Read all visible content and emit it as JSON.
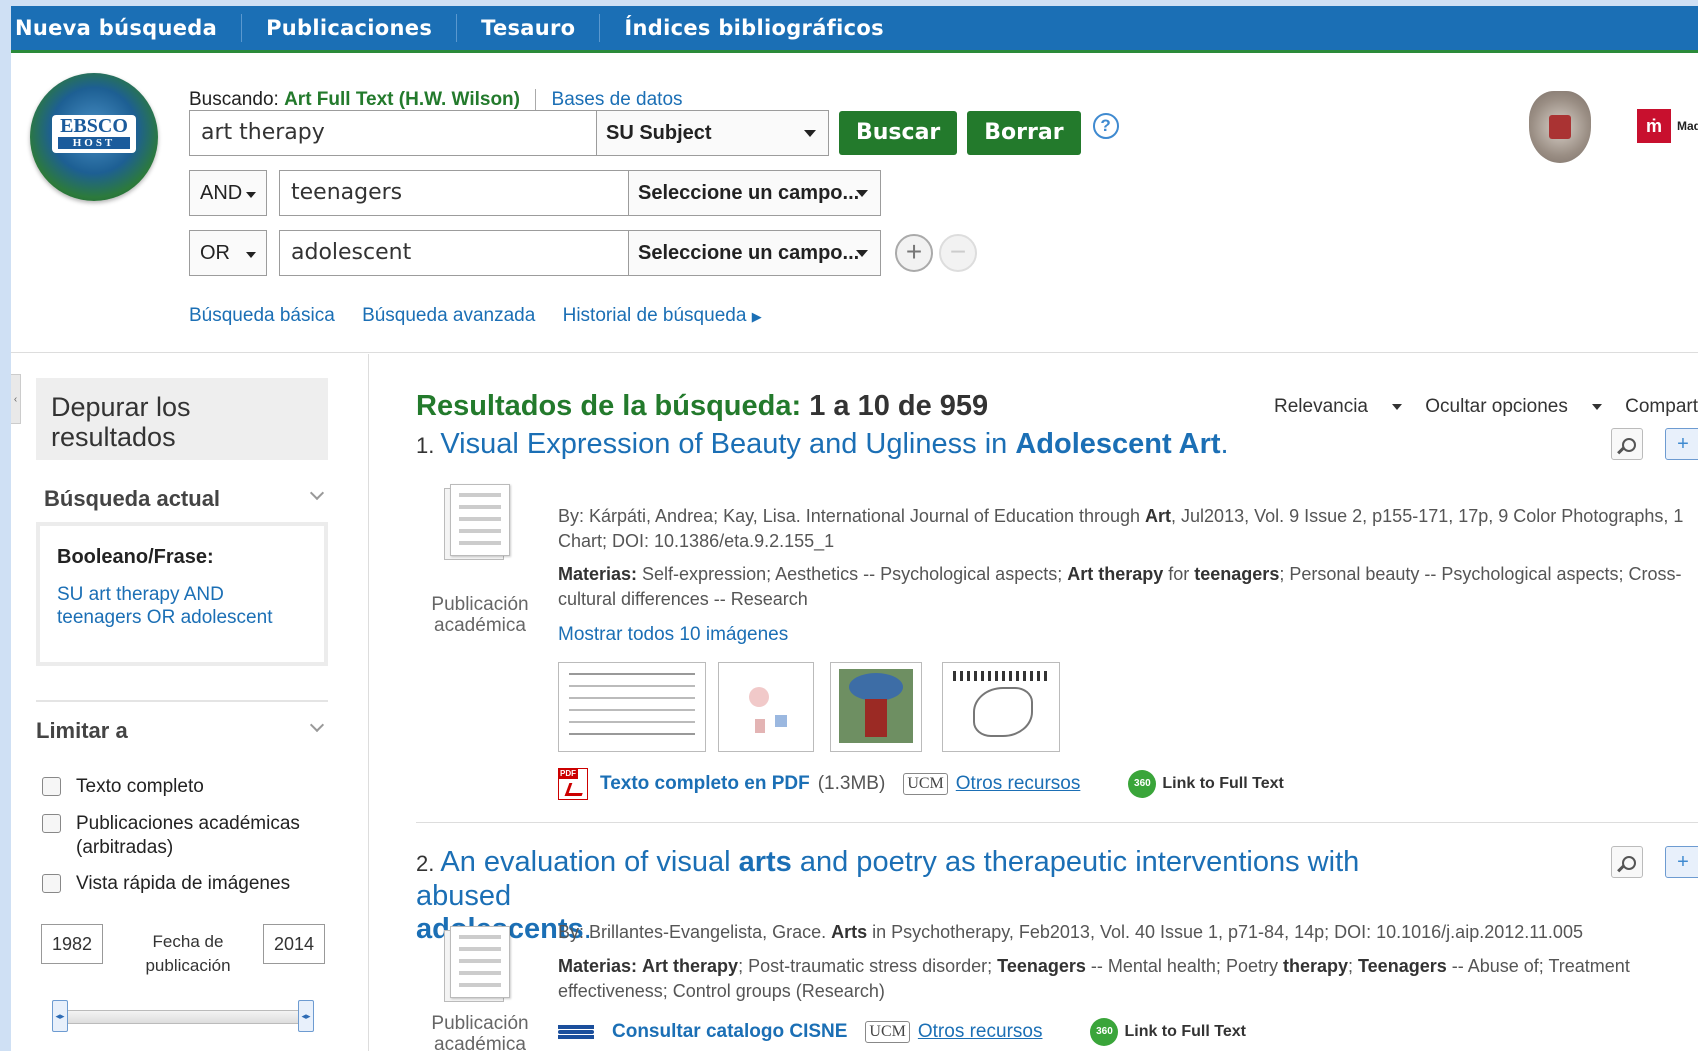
{
  "nav": {
    "items": [
      "Nueva búsqueda",
      "Publicaciones",
      "Tesauro",
      "Índices bibliográficos"
    ]
  },
  "logo": {
    "brand": "EBSCO",
    "sub": "HOST"
  },
  "search": {
    "searching_label": "Buscando:",
    "database": "Art Full Text (H.W. Wilson)",
    "databases_link": "Bases de datos",
    "rows": [
      {
        "op": "",
        "text": "art therapy",
        "field": "SU Subject"
      },
      {
        "op": "AND",
        "text": "teenagers",
        "field": "Seleccione un campo..."
      },
      {
        "op": "OR",
        "text": "adolescent",
        "field": "Seleccione un campo..."
      }
    ],
    "search_button": "Buscar",
    "clear_button": "Borrar",
    "help": "?",
    "add": "+",
    "remove": "−"
  },
  "sublinks": [
    "Búsqueda básica",
    "Búsqueda avanzada",
    "Historial de búsqueda"
  ],
  "madrid_label": "Madr",
  "sidebar": {
    "refine_title": "Depurar los resultados",
    "current_search_title": "Búsqueda actual",
    "boolean_label": "Booleano/Frase:",
    "query": "SU art therapy AND teenagers OR adolescent",
    "limit_title": "Limitar a",
    "limits": [
      "Texto completo",
      "Publicaciones académicas (arbitradas)",
      "Vista rápida de imágenes"
    ],
    "year_from": "1982",
    "year_to": "2014",
    "date_label": "Fecha de publicación",
    "date_range": [
      0.0,
      1.0
    ]
  },
  "results": {
    "heading": "Resultados de la búsqueda:",
    "count": "1 a 10 de 959",
    "sort": "Relevancia",
    "options": "Ocultar opciones",
    "share": "Compartir",
    "items": [
      {
        "num": "1.",
        "title_pre": "Visual Expression of Beauty and Ugliness in ",
        "title_bold": "Adolescent Art",
        "title_post": ".",
        "type": "Publicación académica",
        "cite_pre": "By: Kárpáti, Andrea; Kay, Lisa. International Journal of Education through ",
        "cite_bold": "Art",
        "cite_post": ", Jul2013, Vol. 9 Issue 2, p155-171, 17p, 9 Color Photographs, 1 Chart; DOI: 10.1386/eta.9.2.155_1",
        "mat_label": "Materias:",
        "mat_a": " Self-expression; Aesthetics -- Psychological aspects; ",
        "mat_b1": "Art therapy",
        "mat_c": " for ",
        "mat_b2": "teenagers",
        "mat_d": "; Personal beauty -- Psychological aspects; Cross-cultural differences -- Research",
        "show_images": "Mostrar todos 10 imágenes",
        "pdf_link": "Texto completo en PDF",
        "pdf_size": "(1.3MB)",
        "other": "Otros recursos",
        "link360": "Link to Full Text"
      },
      {
        "num": "2.",
        "title_pre": "An evaluation of visual ",
        "title_bold": "arts",
        "title_post": " and poetry as therapeutic interventions with abused",
        "title_line2": "adolescents",
        "title_line2_post": ".",
        "type": "Publicación académica",
        "cite_pre": "By: Brillantes-Evangelista, Grace. ",
        "cite_bold": "Arts",
        "cite_post": " in Psychotherapy, Feb2013, Vol. 40 Issue 1, p71-84, 14p; DOI: 10.1016/j.aip.2012.11.005",
        "mat_label": "Materias:",
        "mat_b1": "Art therapy",
        "mat_a": "; Post-traumatic stress disorder; ",
        "mat_b2": "Teenagers",
        "mat_c": " -- Mental health; Poetry ",
        "mat_b3": "therapy",
        "mat_c2": "; ",
        "mat_b4": "Teenagers",
        "mat_d": " -- Abuse of; Treatment effectiveness; Control groups (Research)",
        "catalog": "Consultar catalogo CISNE",
        "other": "Otros recursos",
        "link360": "Link to Full Text"
      }
    ]
  },
  "badges": {
    "ucm": "UCM",
    "b360": "360"
  }
}
